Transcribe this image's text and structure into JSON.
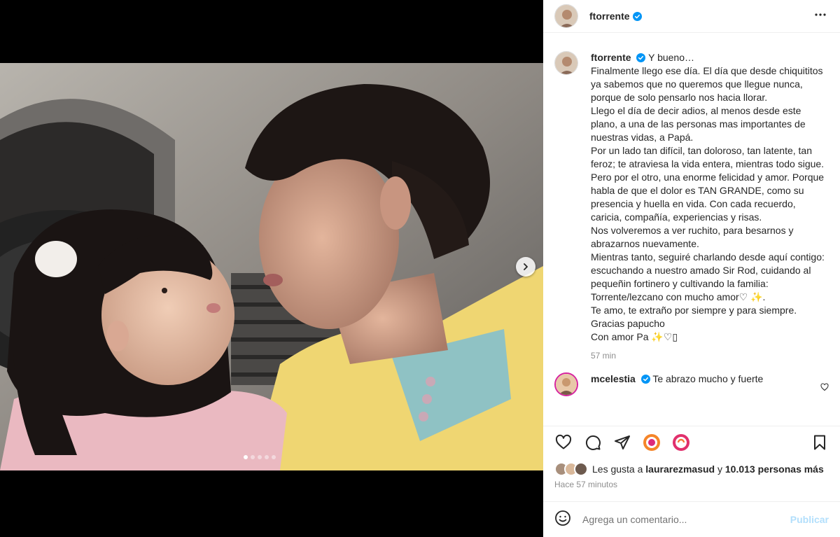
{
  "post": {
    "username": "ftorrente",
    "verified": true,
    "carousel": {
      "slide_count": 5,
      "active_slide": 1
    }
  },
  "caption": {
    "username": "ftorrente",
    "text": "Y bueno…\nFinalmente llego ese día. El día que desde chiquititos ya sabemos que no queremos que llegue nunca, porque de solo pensarlo nos hacia llorar.\nLlego el día de decir adios, al menos desde este plano, a una de las personas mas importantes de nuestras vidas, a Papá.\nPor un lado tan difícil, tan doloroso, tan latente, tan feroz; te atraviesa la vida entera, mientras todo sigue. Pero por el otro, una enorme felicidad y amor. Porque habla de que el dolor es TAN GRANDE, como su presencia y huella en vida. Con cada recuerdo, caricia, compañía, experiencias y risas.\nNos volveremos a ver ruchito, para besarnos y abrazarnos nuevamente.\nMientras tanto, seguiré charlando desde aquí contigo: escuchando a nuestro amado Sir Rod, cuidando al pequeñin fortinero y cultivando la familia: Torrente/lezcano con mucho amor♡ ✨.\nTe amo, te extraño por siempre y para siempre.\nGracias papucho\nCon amor Pa ✨♡▯",
    "time": "57 min"
  },
  "comments": [
    {
      "username": "mcelestia",
      "text": "Te abrazo mucho y fuerte"
    }
  ],
  "likes": {
    "prefix": "Les gusta a ",
    "user": "laurarezmasud",
    "middle": " y ",
    "count": "10.013 personas más"
  },
  "timestamp": "Hace 57 minutos",
  "add_comment": {
    "placeholder": "Agrega un comentario...",
    "publish_label": "Publicar"
  },
  "colors": {
    "verified": "#0095f6",
    "publish_disabled": "#b2dffc",
    "story_ring": "#d6249f"
  }
}
